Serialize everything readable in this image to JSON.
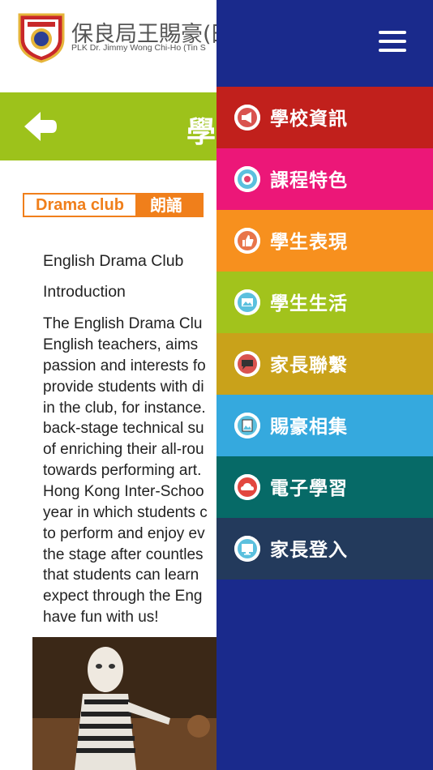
{
  "header": {
    "school_name": "保良局王賜豪(田",
    "school_subtitle": "PLK Dr. Jimmy Wong Chi-Ho (Tin S"
  },
  "titlebar": {
    "title": "學"
  },
  "tabs": [
    {
      "label": "Drama club"
    },
    {
      "label": "朗誦"
    }
  ],
  "article": {
    "heading": "English Drama Club",
    "subheading": "Introduction",
    "lines": [
      "The English Drama Clu",
      "English teachers, aims",
      "passion and interests fo",
      "provide students with di",
      "in the club, for instance.",
      "back-stage technical su",
      "of enriching their all-rou",
      "towards performing art.",
      "Hong Kong Inter-Schoo",
      "year in which students c",
      "to perform and enjoy ev",
      "the stage after countles",
      "that students can learn",
      "expect through the Eng",
      "have fun with us!"
    ]
  },
  "menu": {
    "items": [
      {
        "label": "學校資訊",
        "color": "#c1201c",
        "icon": "megaphone-icon"
      },
      {
        "label": "課程特色",
        "color": "#ec1778",
        "icon": "target-icon"
      },
      {
        "label": "學生表現",
        "color": "#f7901e",
        "icon": "thumbs-up-icon"
      },
      {
        "label": "學生生活",
        "color": "#a2c31c",
        "icon": "image-icon"
      },
      {
        "label": "家長聯繫",
        "color": "#c9a21a",
        "icon": "chat-icon"
      },
      {
        "label": "賜豪相集",
        "color": "#35a9de",
        "icon": "photo-icon"
      },
      {
        "label": "電子學習",
        "color": "#066a67",
        "icon": "cloud-icon"
      },
      {
        "label": "家長登入",
        "color": "#233a5c",
        "icon": "monitor-icon"
      }
    ]
  }
}
